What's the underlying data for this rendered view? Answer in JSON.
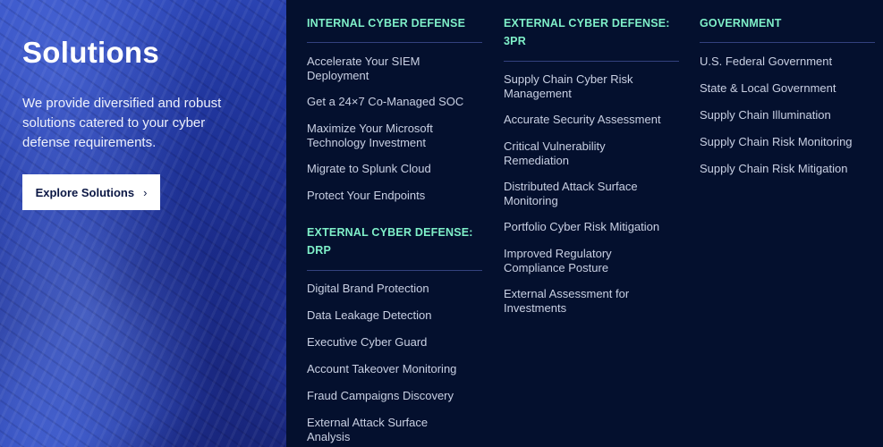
{
  "hero": {
    "title": "Solutions",
    "description": "We provide diversified and robust solutions catered to your cyber defense requirements.",
    "button_label": "Explore Solutions",
    "button_icon": "chevron-right-icon"
  },
  "columns": [
    {
      "heading": "INTERNAL CYBER DEFENSE",
      "items": [
        "Accelerate Your SIEM Deployment",
        "Get a 24×7 Co-Managed SOC",
        "Maximize Your Microsoft Technology Investment",
        "Migrate to Splunk Cloud",
        "Protect Your Endpoints"
      ]
    },
    {
      "heading": "EXTERNAL CYBER DEFENSE: DRP",
      "items": [
        "Digital Brand Protection",
        "Data Leakage Detection",
        "Executive Cyber Guard",
        "Account Takeover Monitoring",
        "Fraud Campaigns Discovery",
        "External Attack Surface Analysis"
      ]
    },
    {
      "heading": "EXTERNAL CYBER DEFENSE: 3PR",
      "items": [
        "Supply Chain Cyber Risk Management",
        "Accurate Security Assessment",
        "Critical Vulnerability Remediation",
        "Distributed Attack Surface Monitoring",
        "Portfolio Cyber Risk Mitigation",
        "Improved Regulatory Compliance Posture",
        "External Assessment for Investments"
      ]
    },
    {
      "heading": "GOVERNMENT",
      "items": [
        "U.S. Federal Government",
        "State & Local Government",
        "Supply Chain Illumination",
        "Supply Chain Risk Monitoring",
        "Supply Chain Risk Mitigation"
      ]
    }
  ],
  "colors": {
    "background": "#04102e",
    "heading": "#7ff0c9",
    "link": "#c9d0e3",
    "divider": "#33417e",
    "hero_blue": "#2137a0"
  }
}
